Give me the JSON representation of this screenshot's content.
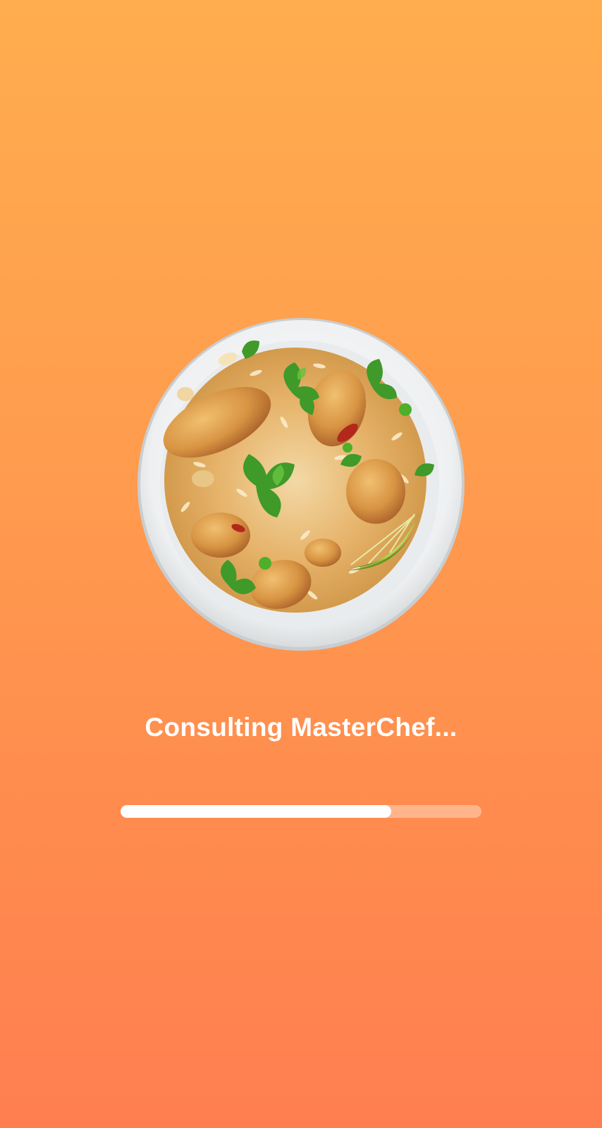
{
  "status": {
    "message": "Consulting MasterChef..."
  },
  "progress": {
    "fraction": 0.75
  },
  "illustration": {
    "icon": "biryani-bowl-image"
  },
  "colors": {
    "background_top": "#FFAD4E",
    "background_bottom": "#FF7E50",
    "text": "#FFFFFF",
    "progress_fill": "#FFFFFF",
    "progress_track": "rgba(255,255,255,0.35)"
  }
}
